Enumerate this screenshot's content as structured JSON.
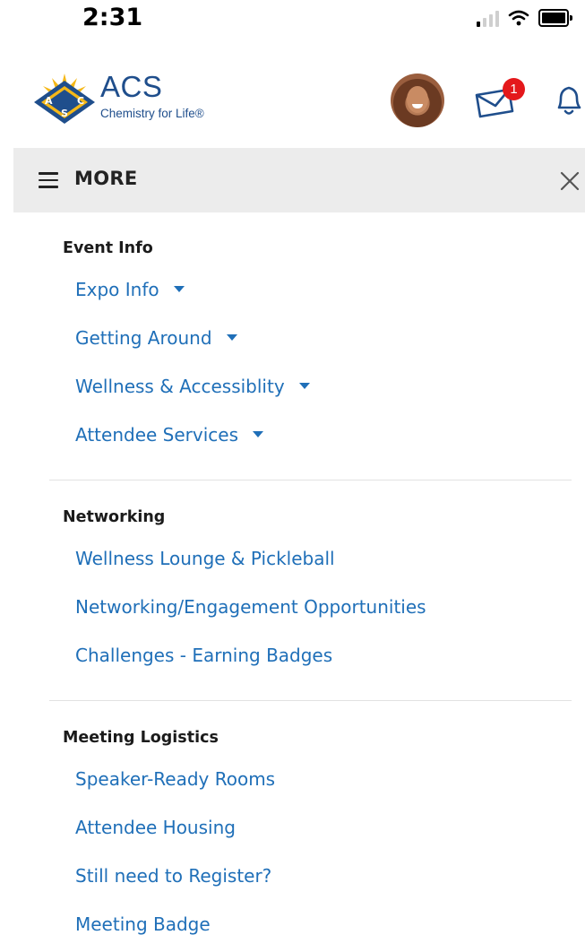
{
  "status_bar": {
    "time": "2:31"
  },
  "header": {
    "logo_text": "ACS",
    "logo_tagline": "Chemistry for Life®",
    "logo_mark_letters": [
      "A",
      "C",
      "S"
    ],
    "mail_badge_count": "1",
    "brand_color": "#1f4e8c",
    "badge_color": "#e4181b"
  },
  "more_bar": {
    "title": "MORE"
  },
  "sections": [
    {
      "title": "Event Info",
      "items": [
        {
          "label": "Expo Info",
          "has_dropdown": true
        },
        {
          "label": "Getting Around",
          "has_dropdown": true
        },
        {
          "label": "Wellness & Accessiblity",
          "has_dropdown": true
        },
        {
          "label": "Attendee Services",
          "has_dropdown": true
        }
      ]
    },
    {
      "title": "Networking",
      "items": [
        {
          "label": "Wellness Lounge & Pickleball"
        },
        {
          "label": "Networking/Engagement Opportunities"
        },
        {
          "label": "Challenges - Earning Badges"
        }
      ]
    },
    {
      "title": "Meeting Logistics",
      "items": [
        {
          "label": "Speaker-Ready Rooms"
        },
        {
          "label": "Attendee Housing"
        },
        {
          "label": "Still need to Register?"
        },
        {
          "label": "Meeting Badge"
        }
      ]
    }
  ],
  "colors": {
    "link": "#1f6fb8",
    "bar_background": "#ececec"
  }
}
